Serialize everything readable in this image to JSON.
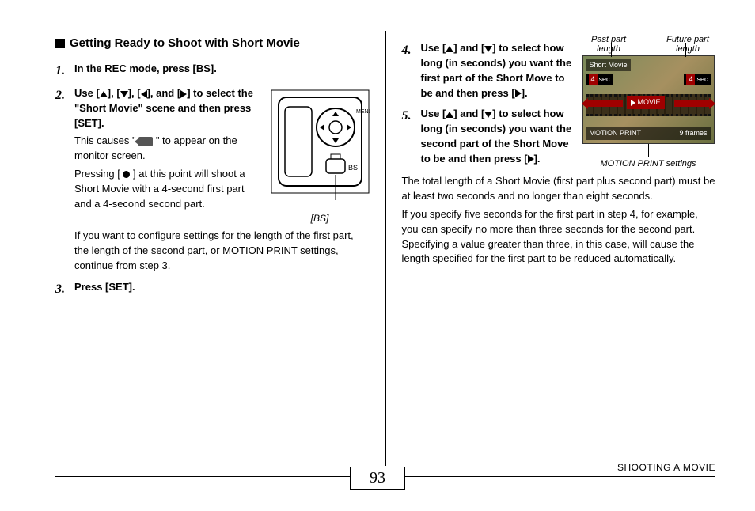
{
  "heading": "Getting Ready to Shoot with Short Movie",
  "step1": {
    "text": "In the REC mode, press [BS]."
  },
  "step2": {
    "bold_a": "Use [",
    "bold_b": "], [",
    "bold_c": "], [",
    "bold_d": "], and [",
    "bold_e": "] to select the \"Short Movie\" scene and then press [SET].",
    "p1a": "This causes \" ",
    "p1b": " \" to appear on the monitor screen.",
    "p2a": "Pressing [ ",
    "p2b": " ] at this point will shoot a Short Movie with a 4-second first part and a 4-second second part.",
    "p3": "If you want to configure settings for the length of the first part, the length of the second part, or MOTION PRINT settings, continue from step 3.",
    "caption": "[BS]"
  },
  "step3": {
    "text": "Press [SET]."
  },
  "step4": {
    "a": "Use [",
    "b": "] and [",
    "c": "] to select how long (in seconds) you want the first part of the Short Move to be and then press [",
    "d": "]."
  },
  "step5": {
    "a": "Use [",
    "b": "] and [",
    "c": "] to select how long (in seconds) you want the second part of the Short Move to be and then press [",
    "d": "].",
    "p1": "The total length of a Short Movie (first part plus second part) must be at least two seconds and no longer than eight seconds.",
    "p2": "If you specify five seconds for the first part in step 4, for example, you can specify no more than three seconds for the second part. Specifying a value greater than three, in this case, will cause the length specified for the first part to be reduced automatically."
  },
  "screen": {
    "label_past": "Past part length",
    "label_future": "Future part length",
    "top": "Short Movie",
    "val_left_num": "4",
    "val_left_unit": "sec",
    "val_right_num": "4",
    "val_right_unit": "sec",
    "movie": "MOVIE",
    "motion": "MOTION PRINT",
    "frames": "9 frames",
    "caption": "MOTION PRINT settings"
  },
  "footer": {
    "page": "93",
    "section": "SHOOTING A MOVIE"
  }
}
